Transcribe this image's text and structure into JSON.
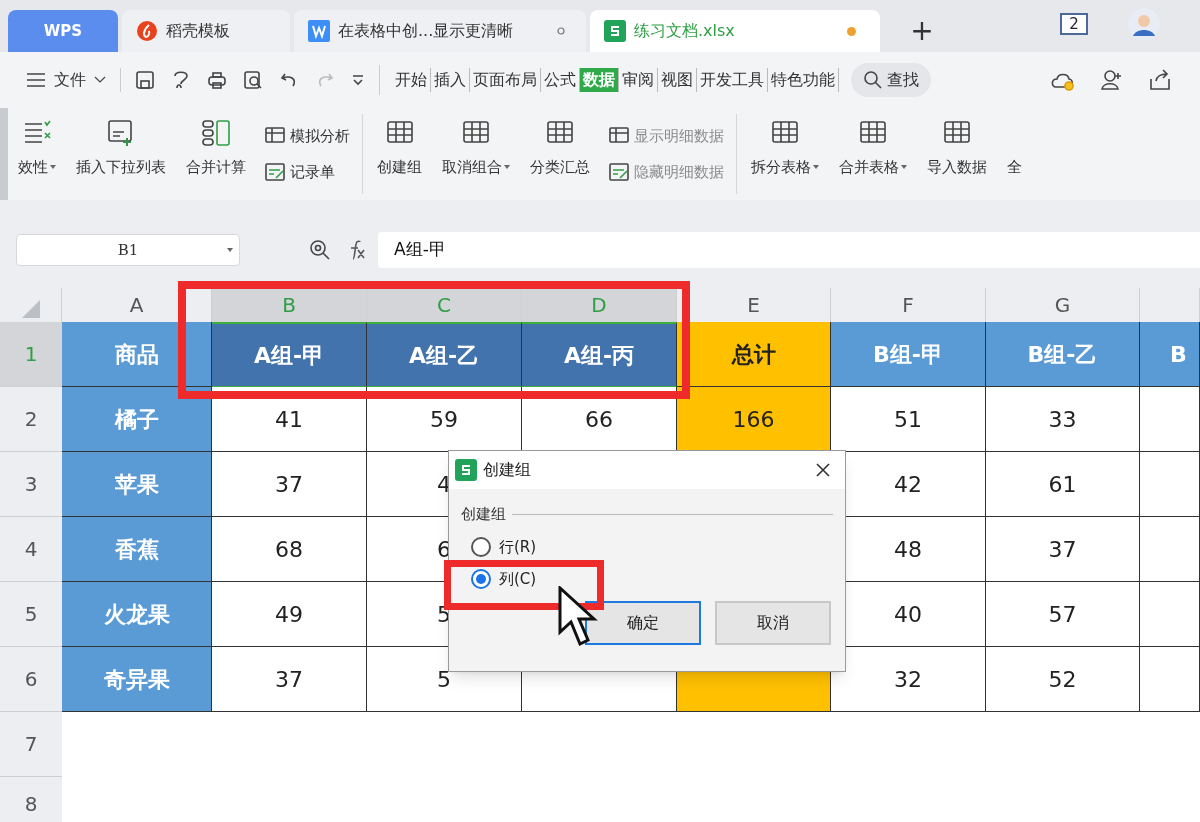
{
  "tabs": [
    {
      "label": "WPS",
      "kind": "brand",
      "selected": false
    },
    {
      "label": "稻壳模板",
      "kind": "template",
      "selected": false
    },
    {
      "label": "在表格中创...显示更清晰",
      "kind": "writer",
      "selected": false,
      "modified": false
    },
    {
      "label": "练习文档.xlsx",
      "kind": "sheet",
      "selected": true,
      "modified": true
    }
  ],
  "new_tab": "+",
  "window_count": "2",
  "menu": {
    "file": "文件",
    "tabs": [
      {
        "label": "开始",
        "selected": false
      },
      {
        "label": "插入",
        "selected": false
      },
      {
        "label": "页面布局",
        "selected": false
      },
      {
        "label": "公式",
        "selected": false
      },
      {
        "label": "数据",
        "selected": true
      },
      {
        "label": "审阅",
        "selected": false
      },
      {
        "label": "视图",
        "selected": false
      },
      {
        "label": "开发工具",
        "selected": false
      },
      {
        "label": "特色功能",
        "selected": false
      }
    ],
    "search": "查找"
  },
  "ribbon": [
    {
      "kind": "large",
      "label": "效性",
      "dropdown": true
    },
    {
      "kind": "large",
      "label": "插入下拉列表",
      "dropdown": false
    },
    {
      "kind": "large",
      "label": "合并计算",
      "dropdown": false
    },
    {
      "kind": "pair",
      "items": [
        {
          "label": "模拟分析",
          "disabled": false
        },
        {
          "label": "记录单",
          "disabled": false
        }
      ]
    },
    {
      "kind": "divider"
    },
    {
      "kind": "large",
      "label": "创建组",
      "dropdown": false
    },
    {
      "kind": "large",
      "label": "取消组合",
      "dropdown": true
    },
    {
      "kind": "large",
      "label": "分类汇总",
      "dropdown": false
    },
    {
      "kind": "pair",
      "items": [
        {
          "label": "显示明细数据",
          "disabled": true
        },
        {
          "label": "隐藏明细数据",
          "disabled": true
        }
      ]
    },
    {
      "kind": "divider"
    },
    {
      "kind": "large",
      "label": "拆分表格",
      "dropdown": true
    },
    {
      "kind": "large",
      "label": "合并表格",
      "dropdown": true
    },
    {
      "kind": "large",
      "label": "导入数据",
      "dropdown": false
    },
    {
      "kind": "large",
      "label": "全",
      "dropdown": false
    }
  ],
  "name_box": "B1",
  "formula": "A组-甲",
  "sheet": {
    "columns": [
      {
        "label": "A",
        "kind": "name",
        "selected": false
      },
      {
        "label": "B",
        "kind": "value",
        "selected": true
      },
      {
        "label": "C",
        "kind": "value",
        "selected": true
      },
      {
        "label": "D",
        "kind": "value",
        "selected": true
      },
      {
        "label": "E",
        "kind": "total",
        "selected": false
      },
      {
        "label": "F",
        "kind": "value",
        "selected": false
      },
      {
        "label": "G",
        "kind": "value",
        "selected": false
      },
      {
        "kind": "value",
        "selected": false
      }
    ],
    "row_headers": [
      {
        "label": "1",
        "selected": true
      },
      {
        "label": "2",
        "selected": false
      },
      {
        "label": "3",
        "selected": false
      },
      {
        "label": "4",
        "selected": false
      },
      {
        "label": "5",
        "selected": false
      },
      {
        "label": "6",
        "selected": false
      },
      {
        "label": "7",
        "selected": false
      },
      {
        "label": "8",
        "selected": false
      }
    ],
    "rows": [
      [
        "商品",
        "A组-甲",
        "A组-乙",
        "A组-丙",
        "总计",
        "B组-甲",
        "B组-乙",
        "B"
      ],
      [
        "橘子",
        "41",
        "59",
        "66",
        "166",
        "51",
        "33",
        ""
      ],
      [
        "苹果",
        "37",
        "4",
        "",
        "",
        "42",
        "61",
        ""
      ],
      [
        "香蕉",
        "68",
        "6",
        "",
        "",
        "48",
        "37",
        ""
      ],
      [
        "火龙果",
        "49",
        "5",
        "",
        "",
        "40",
        "57",
        ""
      ],
      [
        "奇异果",
        "37",
        "5",
        "",
        "",
        "32",
        "52",
        ""
      ]
    ]
  },
  "dialog": {
    "title": "创建组",
    "group": "创建组",
    "options": [
      {
        "label": "行(R)",
        "selected": false
      },
      {
        "label": "列(C)",
        "selected": true
      }
    ],
    "buttons": [
      {
        "label": "确定",
        "kind": "primary"
      },
      {
        "label": "取消",
        "kind": "normal"
      }
    ]
  }
}
